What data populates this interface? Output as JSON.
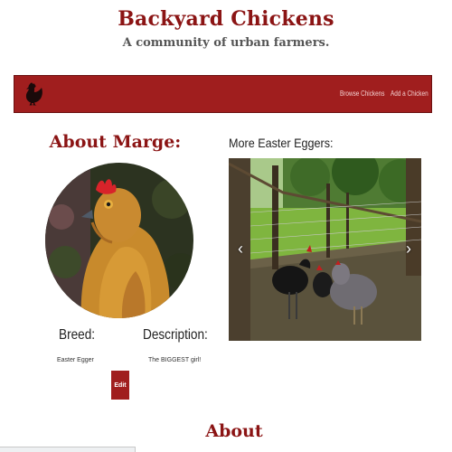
{
  "header": {
    "title": "Backyard Chickens",
    "subtitle": "A community of urban farmers."
  },
  "nav": {
    "logo_icon": "chicken-silhouette-icon",
    "links": [
      "Browse Chickens",
      "Add a Chicken"
    ]
  },
  "profile": {
    "heading": "About Marge:",
    "breed_label": "Breed:",
    "breed_value": "Easter Egger",
    "description_label": "Description:",
    "description_value": "The BIGGEST girl!",
    "edit_label": "Edit"
  },
  "gallery": {
    "heading": "More Easter Eggers:",
    "prev_icon": "chevron-left-icon",
    "next_icon": "chevron-right-icon"
  },
  "footer": {
    "heading": "About"
  },
  "colors": {
    "brand": "#8b1414",
    "navbar": "#a01e1e"
  }
}
